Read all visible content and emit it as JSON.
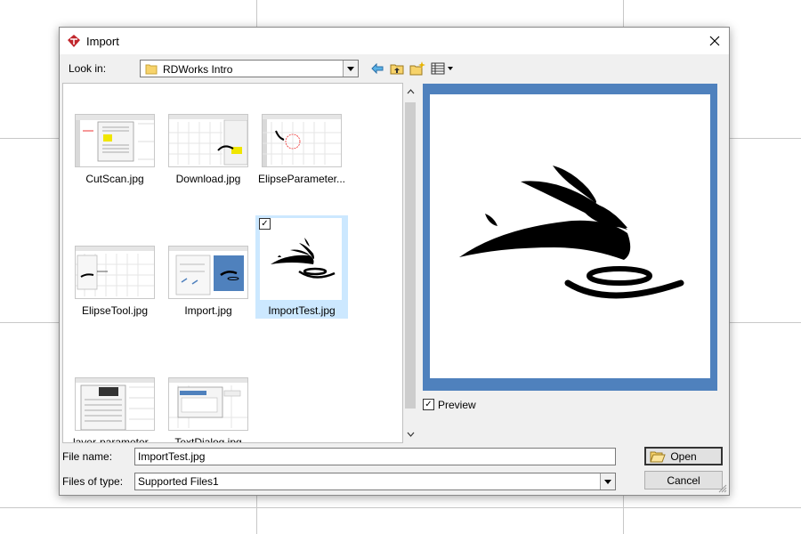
{
  "dialog": {
    "title": "Import"
  },
  "lookin": {
    "label": "Look in:",
    "value": "RDWorks Intro"
  },
  "files": [
    {
      "name": "CutScan.jpg"
    },
    {
      "name": "Download.jpg"
    },
    {
      "name": "ElipseParameter..."
    },
    {
      "name": "ElipseTool.jpg"
    },
    {
      "name": "Import.jpg"
    },
    {
      "name": "ImportTest.jpg",
      "selected": true
    },
    {
      "name": "layer-parameter..."
    },
    {
      "name": "TextDialog.jpg"
    }
  ],
  "preview": {
    "checkbox_label": "Preview",
    "checked": true
  },
  "filename": {
    "label": "File name:",
    "value": "ImportTest.jpg"
  },
  "filetype": {
    "label": "Files of type:",
    "value": "Supported Files1"
  },
  "buttons": {
    "open": "Open",
    "cancel": "Cancel"
  },
  "icons": {
    "app": "rdworks-icon",
    "close": "close-icon",
    "back": "back-arrow-icon",
    "up": "up-folder-icon",
    "new_folder": "new-folder-icon",
    "view_menu": "view-menu-icon"
  },
  "colors": {
    "preview_border": "#4f81bd",
    "selection": "#cce8ff"
  }
}
